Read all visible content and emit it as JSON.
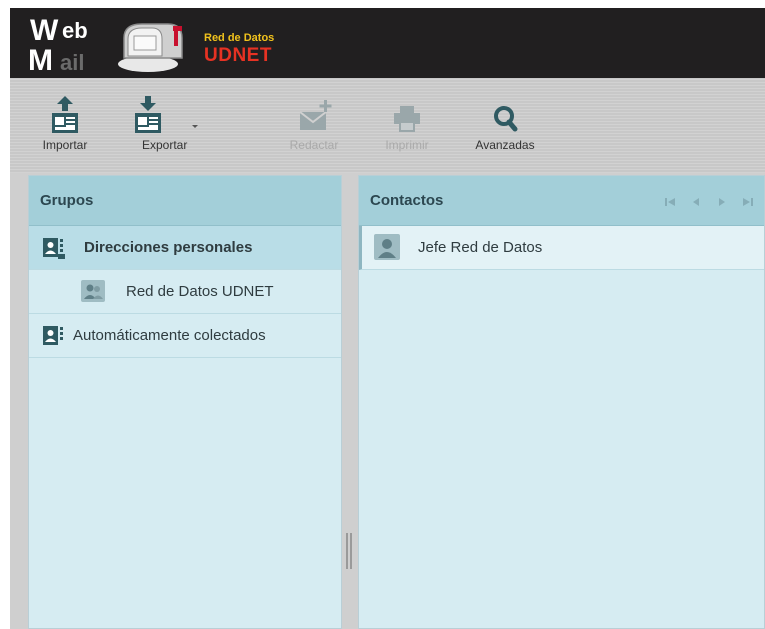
{
  "brand": {
    "webmail_line1": "eb",
    "webmail_line2": "ail",
    "org_top": "Red de Datos",
    "org_bottom": "UDNET"
  },
  "toolbar": {
    "import_label": "Importar",
    "export_label": "Exportar",
    "compose_label": "Redactar",
    "print_label": "Imprimir",
    "advanced_label": "Avanzadas"
  },
  "groups": {
    "header": "Grupos",
    "items": [
      {
        "label": "Direcciones personales",
        "selected": true
      },
      {
        "label": "Red de Datos UDNET",
        "selected": false
      },
      {
        "label": "Automáticamente colectados",
        "selected": false
      }
    ]
  },
  "contacts": {
    "header": "Contactos",
    "items": [
      {
        "label": "Jefe Red de Datos"
      }
    ]
  },
  "colors": {
    "topbar": "#211f20",
    "panel_header": "#a3cfd9",
    "panel_body": "#d6ecf2",
    "icon_teal": "#2f5a62",
    "brand_red": "#e63223",
    "brand_yellow": "#f1c21c"
  }
}
